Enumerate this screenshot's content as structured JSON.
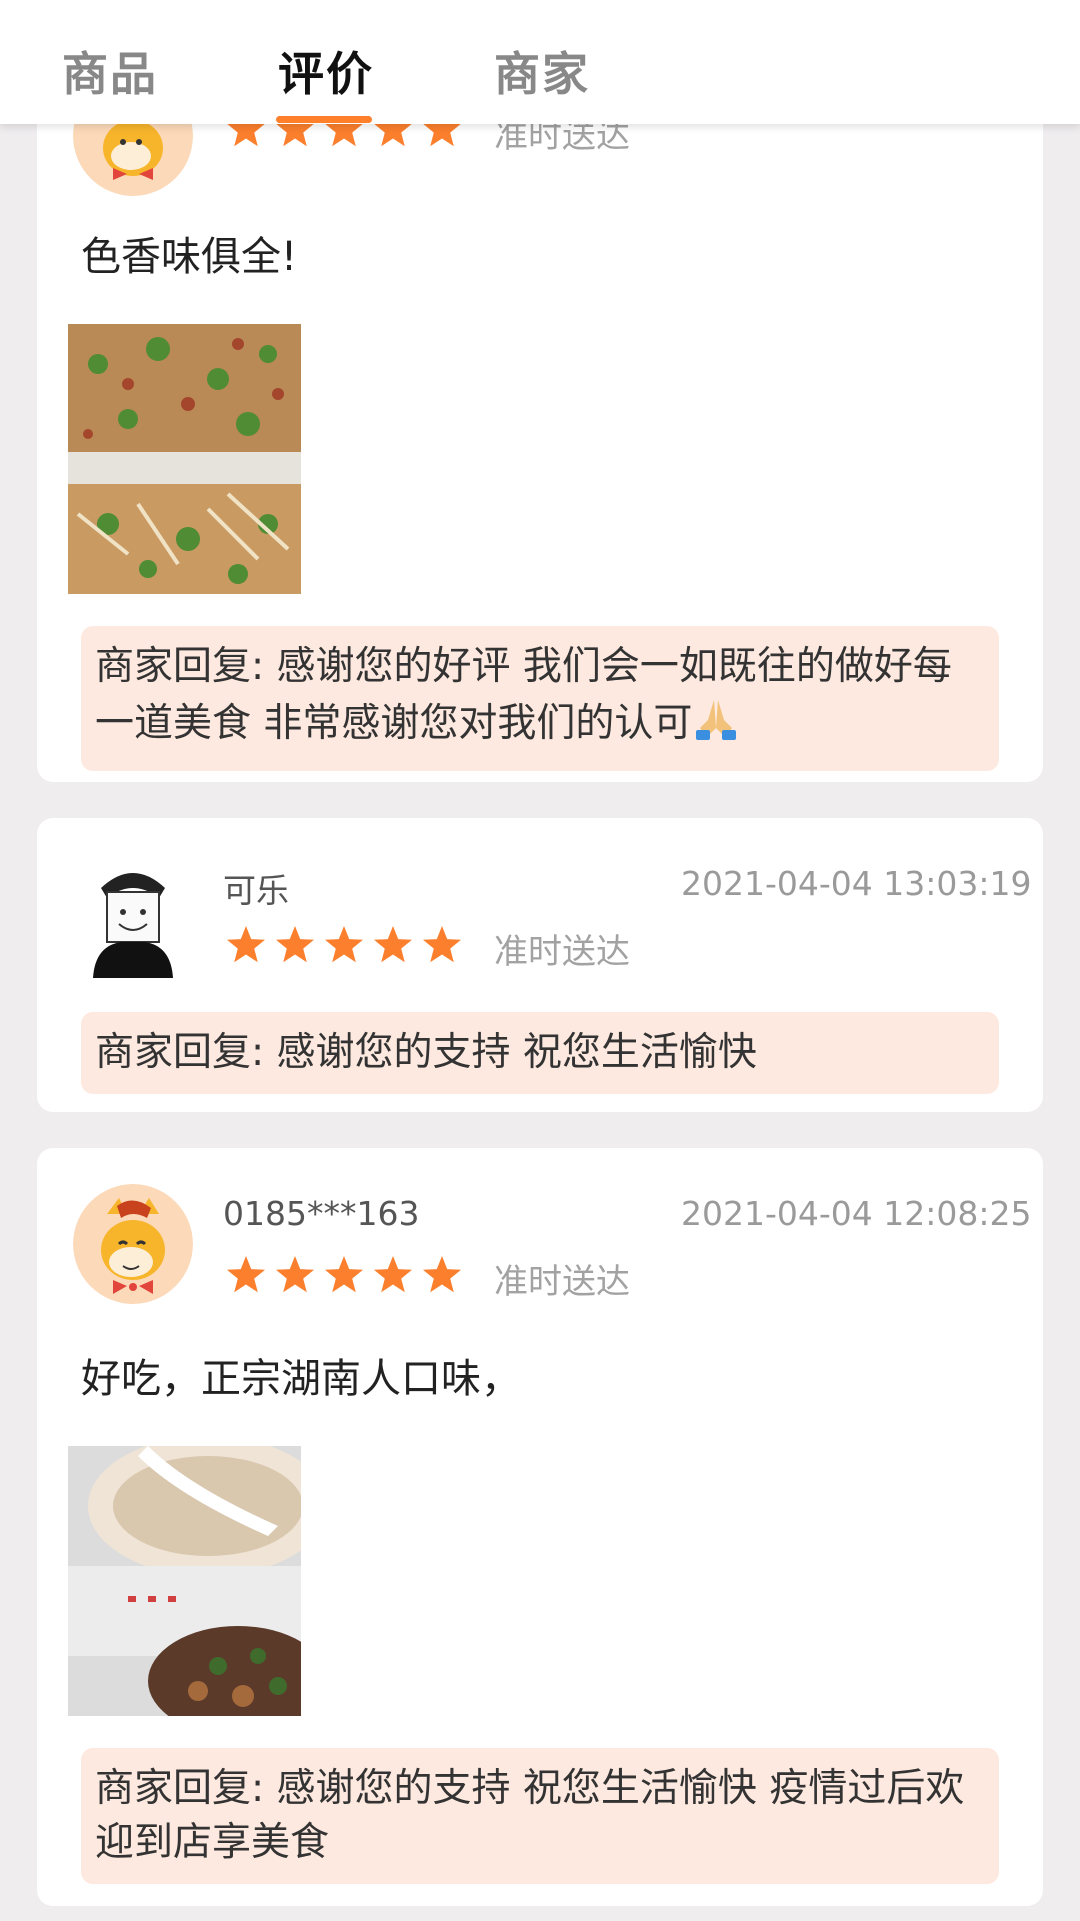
{
  "tabs": [
    {
      "label": "商品"
    },
    {
      "label": "评价"
    },
    {
      "label": "商家"
    }
  ],
  "accent_color": "#ff7f2a",
  "star_color": "#fb7f2c",
  "reviews": [
    {
      "username": "",
      "time": "",
      "rating": 5,
      "tag": "准时送达",
      "comment": "色香味俱全!",
      "has_photo": true,
      "reply": "商家回复: 感谢您的好评 我们会一如既往的做好每一道美食 非常感谢您对我们的认可"
    },
    {
      "username": "可乐",
      "time": "2021-04-04 13:03:19",
      "rating": 5,
      "tag": "准时送达",
      "comment": "",
      "has_photo": false,
      "reply": "商家回复: 感谢您的支持 祝您生活愉快"
    },
    {
      "username": "0185***163",
      "time": "2021-04-04 12:08:25",
      "rating": 5,
      "tag": "准时送达",
      "comment": "好吃，正宗湖南人口味，",
      "has_photo": true,
      "reply": "商家回复: 感谢您的支持 祝您生活愉快 疫情过后欢迎到店享美食"
    }
  ]
}
